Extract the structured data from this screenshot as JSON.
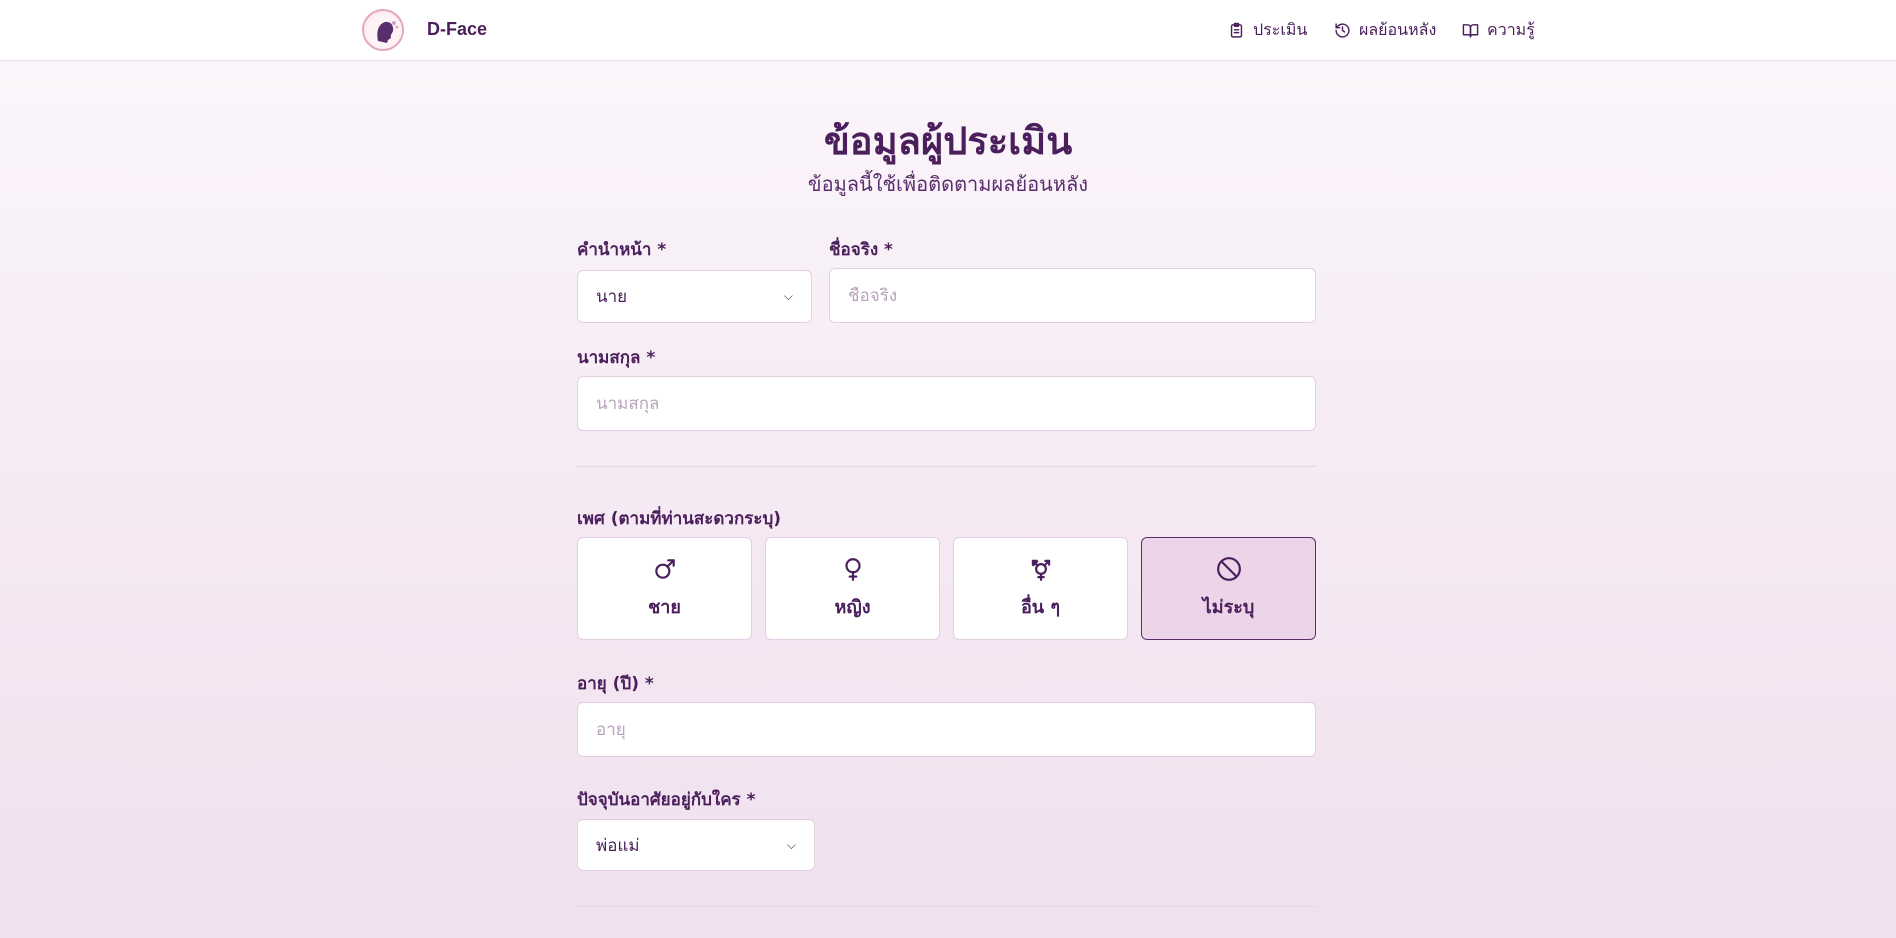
{
  "header": {
    "brand": "D-Face",
    "nav": [
      {
        "label": "ประเมิน",
        "icon": "clipboard-icon"
      },
      {
        "label": "ผลย้อนหลัง",
        "icon": "history-icon"
      },
      {
        "label": "ความรู้",
        "icon": "book-icon"
      }
    ]
  },
  "page": {
    "title": "ข้อมูลผู้ประเมิน",
    "subtitle": "ข้อมูลนี้ใช้เพื่อติดตามผลย้อนหลัง"
  },
  "form": {
    "prefix": {
      "label": "คำนำหน้า *",
      "value": "นาย"
    },
    "first_name": {
      "label": "ชื่อจริง *",
      "placeholder": "ชื่อจริง",
      "value": ""
    },
    "last_name": {
      "label": "นามสกุล *",
      "placeholder": "นามสกุล",
      "value": ""
    },
    "gender": {
      "label": "เพศ (ตามที่ท่านสะดวกระบุ)",
      "options": [
        {
          "label": "ชาย",
          "icon": "male-icon",
          "selected": false
        },
        {
          "label": "หญิง",
          "icon": "female-icon",
          "selected": false
        },
        {
          "label": "อื่น ๆ",
          "icon": "transgender-icon",
          "selected": false
        },
        {
          "label": "ไม่ระบุ",
          "icon": "ban-icon",
          "selected": true
        }
      ]
    },
    "age": {
      "label": "อายุ (ปี) *",
      "placeholder": "อายุ",
      "value": ""
    },
    "living_with": {
      "label": "ปัจจุบันอาศัยอยู่กับใคร *",
      "value": "พ่อแม่"
    }
  },
  "colors": {
    "primary": "#4a1f5c",
    "selected_bg": "#ecd5e8",
    "border": "#e2cfe2"
  }
}
